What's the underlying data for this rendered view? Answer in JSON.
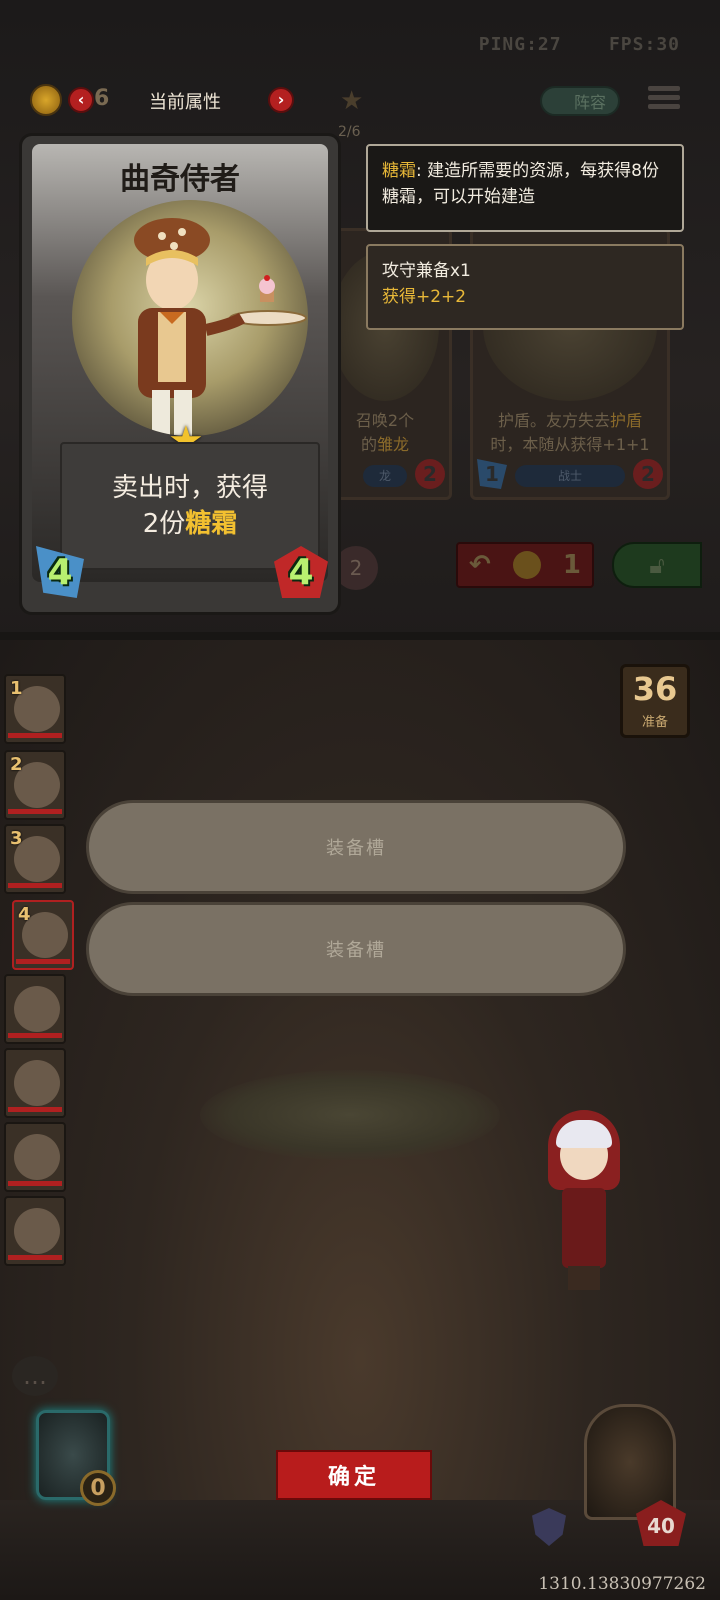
{
  "status": {
    "ping": "PING:27",
    "fps": "FPS:30"
  },
  "top_bar": {
    "coin_count": "6",
    "title": "当前属性",
    "page": "2/6",
    "lineup_label": "阵容"
  },
  "shop_cards": [
    {
      "text_line1": "召唤2个",
      "text_line2a": "的",
      "text_line2b": "雏龙",
      "tribe": "龙",
      "attack": "",
      "health": "2"
    },
    {
      "text_line1a": "护盾。友方失去",
      "text_line1b": "护盾",
      "text_line2": "时，本随从获得+1+1",
      "tribe": "战士",
      "attack": "1",
      "health": "2"
    }
  ],
  "refresh": {
    "cost": "1"
  },
  "flower_count": "2",
  "featured_card": {
    "name": "曲奇侍者",
    "desc_line1": "卖出时，获得",
    "desc_line2_prefix": "2份",
    "desc_line2_keyword": "糖霜",
    "attack": "4",
    "health": "4"
  },
  "tooltips": {
    "keyword": "糖霜",
    "keyword_desc": ": 建造所需要的资源，每获得8份糖霜，可以开始建造",
    "trait_name": "攻守兼备x1",
    "trait_effect": "获得+2+2"
  },
  "side_slots": [
    {
      "num": "1"
    },
    {
      "num": "2"
    },
    {
      "num": "3"
    },
    {
      "num": "4"
    },
    {
      "num": ""
    },
    {
      "num": ""
    },
    {
      "num": ""
    },
    {
      "num": ""
    }
  ],
  "deck": {
    "count": "36",
    "label": "准备"
  },
  "equip_slots": [
    "装备槽",
    "装备槽"
  ],
  "hero": {
    "coins": "0"
  },
  "confirm_label": "确定",
  "enemy": {
    "health": "40"
  },
  "version": "1310.13830977262",
  "colors": {
    "accent_red": "#b81c1c",
    "keyword_gold": "#e8b838",
    "star_gold": "#f2c22c"
  }
}
